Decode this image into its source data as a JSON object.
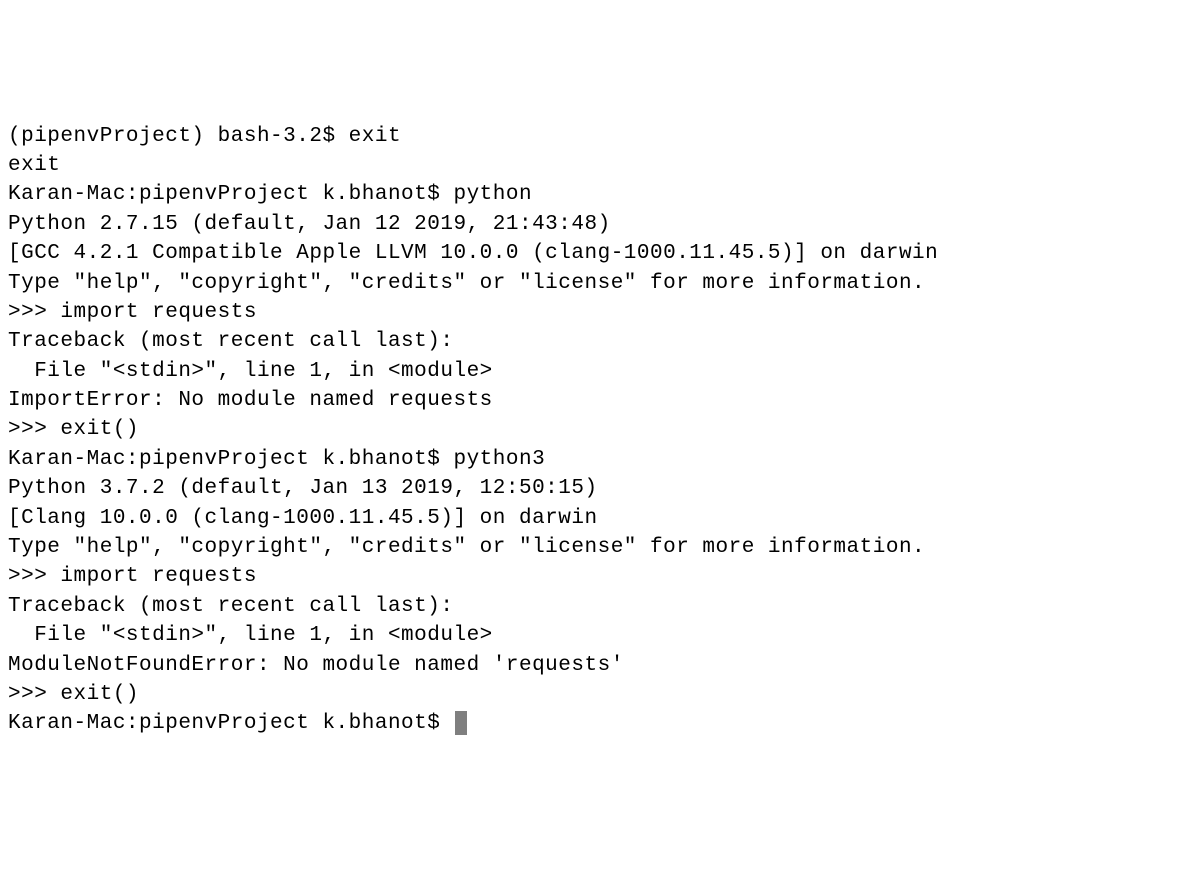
{
  "terminal": {
    "lines": [
      "(pipenvProject) bash-3.2$ exit",
      "exit",
      "Karan-Mac:pipenvProject k.bhanot$ python",
      "Python 2.7.15 (default, Jan 12 2019, 21:43:48)",
      "[GCC 4.2.1 Compatible Apple LLVM 10.0.0 (clang-1000.11.45.5)] on darwin",
      "Type \"help\", \"copyright\", \"credits\" or \"license\" for more information.",
      ">>> import requests",
      "Traceback (most recent call last):",
      "  File \"<stdin>\", line 1, in <module>",
      "ImportError: No module named requests",
      ">>> exit()",
      "Karan-Mac:pipenvProject k.bhanot$ python3",
      "Python 3.7.2 (default, Jan 13 2019, 12:50:15)",
      "[Clang 10.0.0 (clang-1000.11.45.5)] on darwin",
      "Type \"help\", \"copyright\", \"credits\" or \"license\" for more information.",
      ">>> import requests",
      "Traceback (most recent call last):",
      "  File \"<stdin>\", line 1, in <module>",
      "ModuleNotFoundError: No module named 'requests'",
      ">>> exit()",
      "Karan-Mac:pipenvProject k.bhanot$ "
    ]
  }
}
